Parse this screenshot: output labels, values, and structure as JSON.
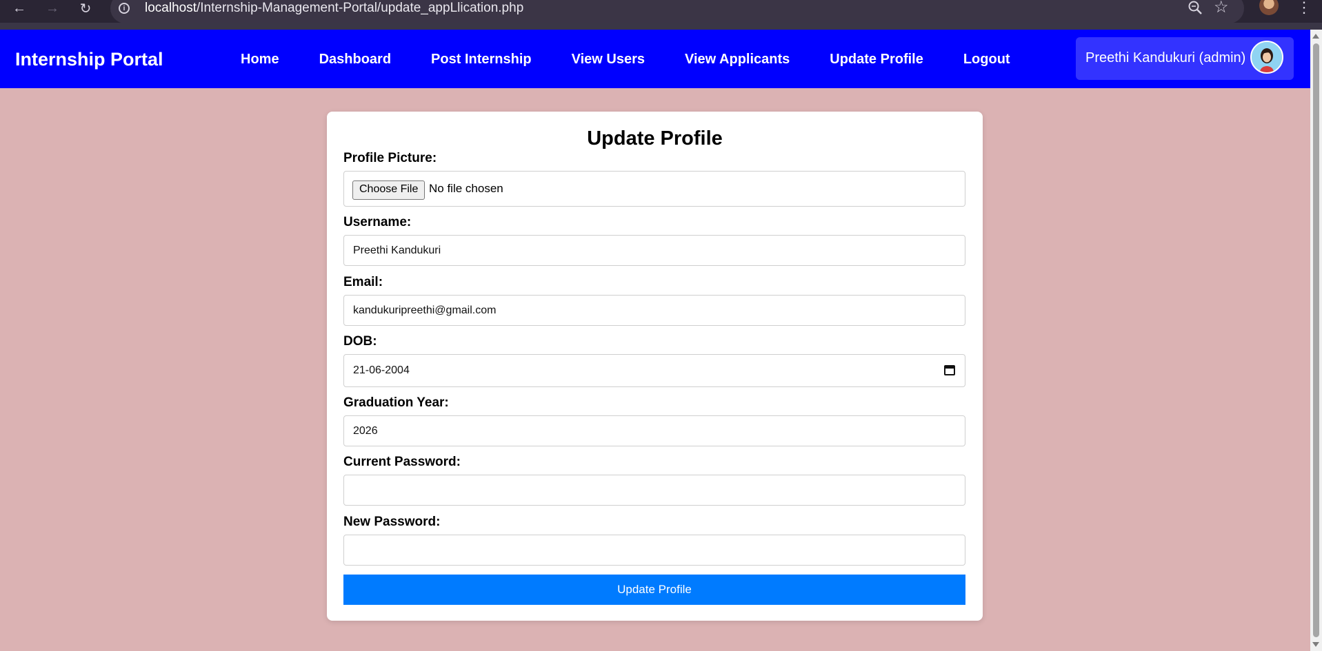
{
  "browser": {
    "url_host": "localhost",
    "url_path": "/Internship-Management-Portal/update_appLlication.php"
  },
  "nav": {
    "brand": "Internship Portal",
    "links": [
      "Home",
      "Dashboard",
      "Post Internship",
      "View Users",
      "View Applicants",
      "Update Profile",
      "Logout"
    ],
    "user_label": "Preethi Kandukuri (admin)"
  },
  "form": {
    "title": "Update Profile",
    "profile_picture": {
      "label": "Profile Picture:",
      "button": "Choose File",
      "status": "No file chosen"
    },
    "username": {
      "label": "Username:",
      "value": "Preethi Kandukuri"
    },
    "email": {
      "label": "Email:",
      "value": "kandukuripreethi@gmail.com"
    },
    "dob": {
      "label": "DOB:",
      "value": "21-06-2004"
    },
    "graduation_year": {
      "label": "Graduation Year:",
      "value": "2026"
    },
    "current_password": {
      "label": "Current Password:",
      "value": ""
    },
    "new_password": {
      "label": "New Password:",
      "value": ""
    },
    "submit_label": "Update Profile"
  },
  "colors": {
    "nav_bg": "#0000ff",
    "page_bg": "#dbb2b3",
    "submit_bg": "#007bff"
  }
}
